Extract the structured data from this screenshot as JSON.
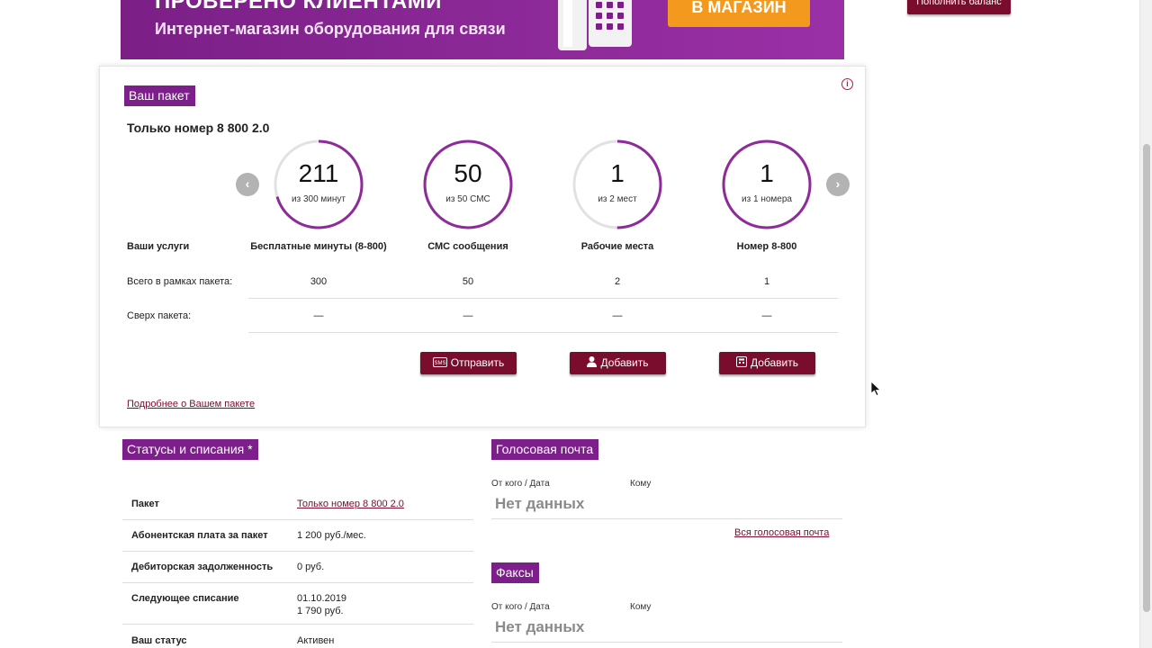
{
  "banner": {
    "title": "ПРОВЕРЕНО КЛИЕНТАМИ",
    "subtitle": "Интернет-магазин оборудования для связи",
    "button_label": "В МАГАЗИН",
    "bg_color": "#8e2a9a",
    "button_color": "#f39a1e"
  },
  "top_button": "Пополнить баланс",
  "package": {
    "section_title": "Ваш пакет",
    "info_glyph": "i",
    "name": "Только номер 8 800 2.0",
    "prev_glyph": "‹",
    "next_glyph": "›",
    "row_labels": {
      "services": "Ваши услуги",
      "total": "Всего в рамках пакета:",
      "over": "Сверх пакета:"
    },
    "columns": [
      {
        "value": "211",
        "sub": "из 300 минут",
        "fraction": 0.703,
        "title": "Бесплатные минуты (8-800)",
        "total": "300",
        "over": "—"
      },
      {
        "value": "50",
        "sub": "из 50 СМС",
        "fraction": 1.0,
        "title": "СМС сообщения",
        "total": "50",
        "over": "—"
      },
      {
        "value": "1",
        "sub": "из 2 мест",
        "fraction": 0.5,
        "title": "Рабочие места",
        "total": "2",
        "over": "—"
      },
      {
        "value": "1",
        "sub": "из 1 номера",
        "fraction": 1.0,
        "title": "Номер 8-800",
        "total": "1",
        "over": "—"
      }
    ],
    "actions": [
      {
        "label": "Отправить",
        "icon": "sms-icon"
      },
      {
        "label": "Добавить",
        "icon": "user-icon"
      },
      {
        "label": "Добавить",
        "icon": "phone-book-icon"
      }
    ],
    "more_link": "Подробнее о Вашем пакете",
    "accent_color": "#8e2a9a",
    "track_color": "#e2e2e2",
    "button_color": "#7a0d2e"
  },
  "status": {
    "section_title": "Статусы и списания *",
    "rows": [
      {
        "key": "Пакет",
        "value": "Только номер 8 800 2.0"
      },
      {
        "key": "Абонентская плата за пакет",
        "value": "1 200 руб./мес."
      },
      {
        "key": "Дебиторская задолженность",
        "value": "0 руб."
      },
      {
        "key": "Следующее списание",
        "value": "01.10.2019",
        "value2": "1 790 руб."
      },
      {
        "key": "Ваш статус",
        "value": "Активен"
      }
    ]
  },
  "voicemail": {
    "section_title": "Голосовая почта",
    "col_from": "От кого / Дата",
    "col_to": "Кому",
    "empty": "Нет данных",
    "link": "Вся голосовая почта"
  },
  "faxes": {
    "section_title": "Факсы",
    "col_from": "От кого / Дата",
    "col_to": "Кому",
    "empty": "Нет данных"
  }
}
